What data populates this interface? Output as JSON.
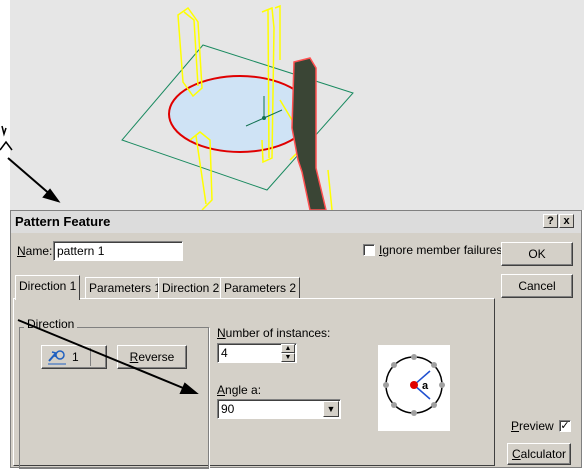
{
  "dialog": {
    "title": "Pattern Feature",
    "help_btn": "?",
    "close_btn": "x",
    "name_label": "Name:",
    "name_value": "pattern 1",
    "ignore_label": "Ignore member failures",
    "ok_label": "OK",
    "cancel_label": "Cancel",
    "preview_label": "Preview",
    "preview_checked": true,
    "calculator_label": "Calculator"
  },
  "tabs": [
    {
      "label": "Direction 1",
      "active": true
    },
    {
      "label": "Parameters 1",
      "active": false
    },
    {
      "label": "Direction 2",
      "active": false
    },
    {
      "label": "Parameters 2",
      "active": false
    }
  ],
  "direction": {
    "group_title": "Direction",
    "selector_value": "1",
    "reverse_label": "Reverse"
  },
  "instances": {
    "label": "Number of instances:",
    "value": "4"
  },
  "angle": {
    "label": "Angle a:",
    "value": "90"
  },
  "diagram": {
    "angle_symbol": "a"
  },
  "colors": {
    "dialog_bg": "#d4d0c8",
    "viewport_bg": "#e6e6e6",
    "edge_yellow": "#ffff00",
    "circle_red": "#e00000",
    "plane_green": "#1a8a60"
  }
}
